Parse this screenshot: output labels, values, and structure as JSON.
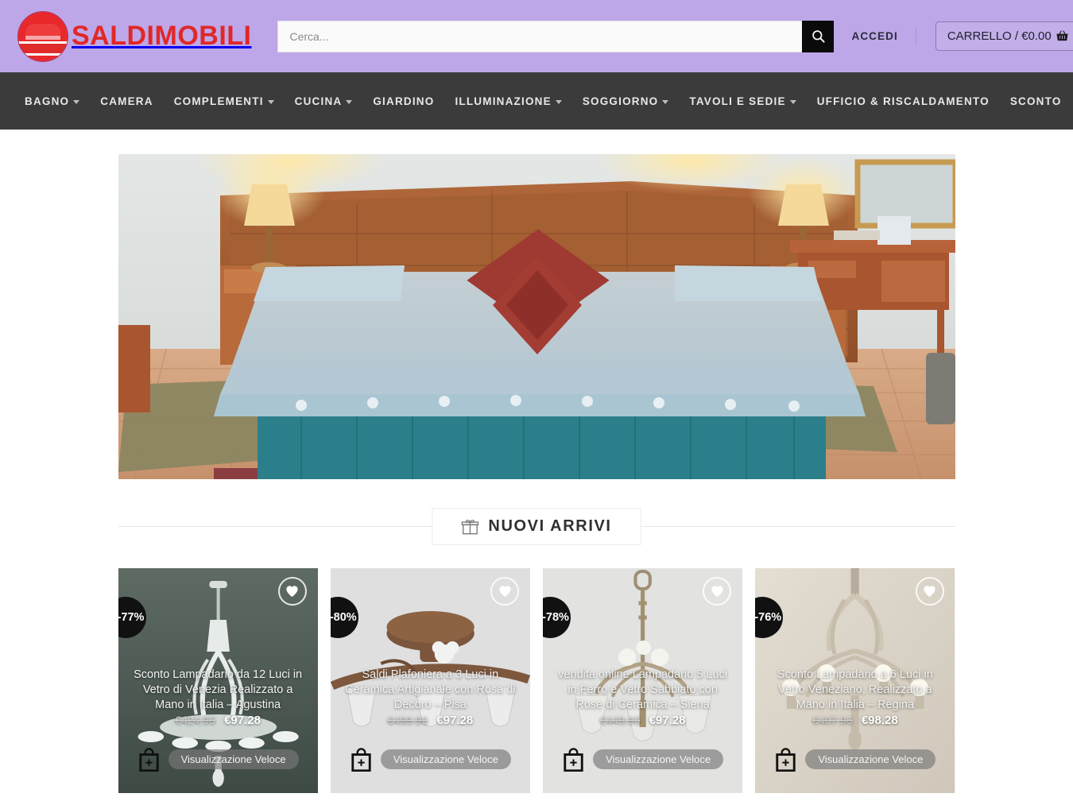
{
  "header": {
    "logo_text": "SALDIMOBILI",
    "logo_icon": "bed-circle-logo",
    "search": {
      "placeholder": "Cerca...",
      "value": "",
      "icon": "search-icon"
    },
    "login_label": "ACCEDI",
    "cart_label": "CARRELLO / €0.00",
    "cart_icon": "shopping-basket-icon",
    "bg_color": "#bda7e8"
  },
  "nav": {
    "bg_color": "#3b3b3b",
    "items": [
      {
        "label": "BAGNO",
        "has_dropdown": true
      },
      {
        "label": "CAMERA",
        "has_dropdown": false
      },
      {
        "label": "COMPLEMENTI",
        "has_dropdown": true
      },
      {
        "label": "CUCINA",
        "has_dropdown": true
      },
      {
        "label": "GIARDINO",
        "has_dropdown": false
      },
      {
        "label": "ILLUMINAZIONE",
        "has_dropdown": true
      },
      {
        "label": "SOGGIORNO",
        "has_dropdown": true
      },
      {
        "label": "TAVOLI E SEDIE",
        "has_dropdown": true
      },
      {
        "label": "UFFICIO & RISCALDAMENTO",
        "has_dropdown": false
      },
      {
        "label": "SCONTO",
        "has_dropdown": false
      }
    ]
  },
  "hero": {
    "alt": "bedroom-interior-photo"
  },
  "section": {
    "title": "NUOVI ARRIVI",
    "icon": "gift-icon"
  },
  "products": [
    {
      "title": "Sconto Lampadario da 12 Luci in Vetro di Venezia Realizzato a Mano in Italia – Agustina",
      "discount": "-77%",
      "old_price": "€424.96",
      "new_price": "€97.28",
      "quick_label": "Visualizzazione Veloce",
      "wish_icon": "heart-icon",
      "cart_icon": "add-to-bag-icon"
    },
    {
      "title": "Saldi Plafoniera a 3 Luci in Ceramica Artigianale con Rosa di Decoro – Pisa",
      "discount": "-80%",
      "old_price": "€499.96",
      "new_price": "€97.28",
      "quick_label": "Visualizzazione Veloce",
      "wish_icon": "heart-icon",
      "cart_icon": "add-to-bag-icon"
    },
    {
      "title": "vendita online Lampadario 5 Luci in Ferro e Vetro Sabbiato con Rose di Ceramica – Siena",
      "discount": "-78%",
      "old_price": "€449.96",
      "new_price": "€97.28",
      "quick_label": "Visualizzazione Veloce",
      "wish_icon": "heart-icon",
      "cart_icon": "add-to-bag-icon"
    },
    {
      "title": "Sconto Lampadario a 6 Luci in Vetro Veneziano, Realizzato a Mano in Italia – Regina",
      "discount": "-76%",
      "old_price": "€407.96",
      "new_price": "€98.28",
      "quick_label": "Visualizzazione Veloce",
      "wish_icon": "heart-icon",
      "cart_icon": "add-to-bag-icon"
    }
  ]
}
